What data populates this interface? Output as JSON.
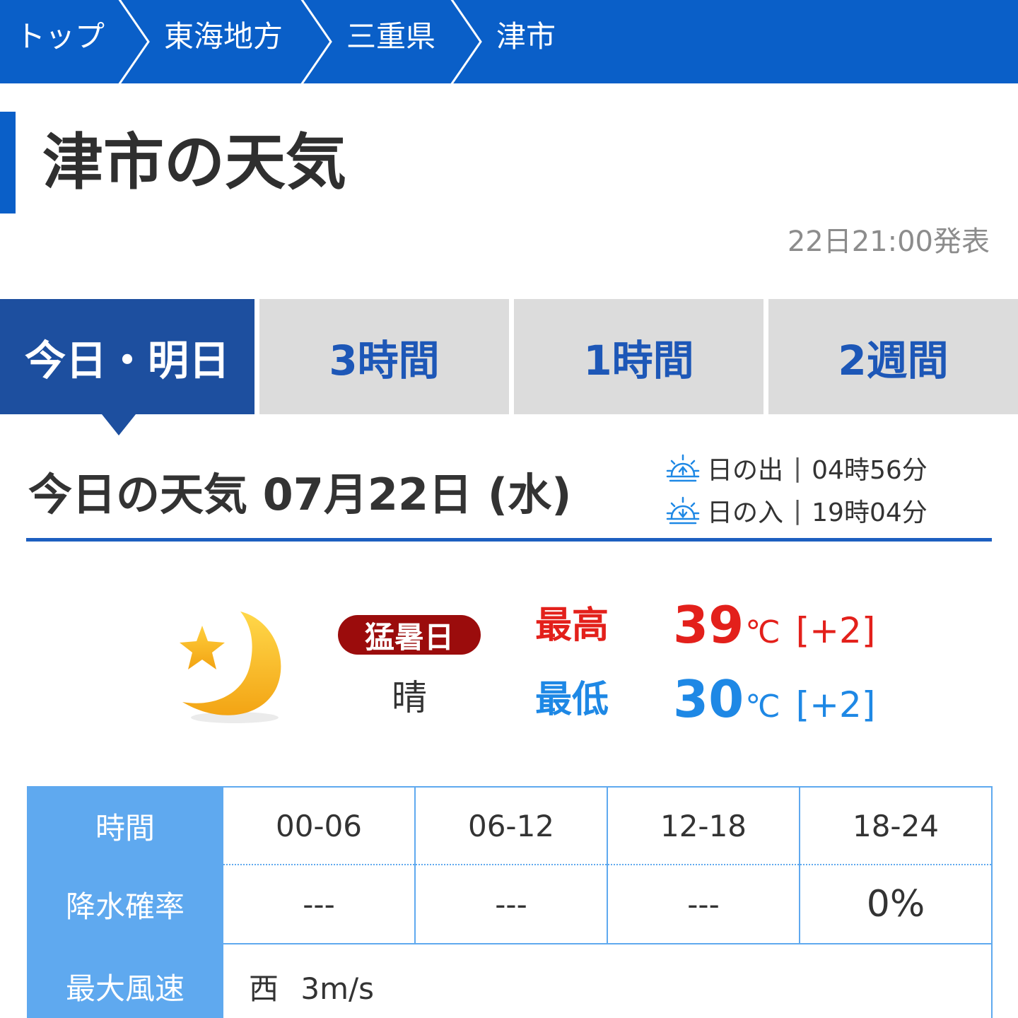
{
  "breadcrumb": {
    "items": [
      "トップ",
      "東海地方",
      "三重県",
      "津市"
    ]
  },
  "page": {
    "title": "津市の天気",
    "published": "22日21:00発表"
  },
  "tabs": [
    {
      "label": "今日・明日",
      "active": true
    },
    {
      "label": "3時間",
      "active": false
    },
    {
      "label": "1時間",
      "active": false
    },
    {
      "label": "2週間",
      "active": false
    }
  ],
  "today": {
    "heading": "今日の天気 07月22日 (水)",
    "sunrise": {
      "label": "日の出",
      "time": "04時56分",
      "icon": "sunrise-icon"
    },
    "sunset": {
      "label": "日の入",
      "time": "19時04分",
      "icon": "sunset-icon"
    },
    "weather_icon": "crescent-moon-with-star-icon",
    "badge": "猛暑日",
    "condition": "晴",
    "high": {
      "label": "最高",
      "value": "39",
      "unit": "℃",
      "diff": "[+2]"
    },
    "low": {
      "label": "最低",
      "value": "30",
      "unit": "℃",
      "diff": "[+2]"
    }
  },
  "table": {
    "time_header": "時間",
    "times": [
      "00-06",
      "06-12",
      "12-18",
      "18-24"
    ],
    "pop_header": "降水確率",
    "pop": [
      "---",
      "---",
      "---",
      "0%"
    ],
    "wind_header": "最大風速",
    "wind_direction": "西",
    "wind_speed": "3m/s"
  },
  "colors": {
    "brand_blue": "#0a5fc8",
    "active_tab": "#1d4f9f",
    "high_temp": "#e3201b",
    "low_temp": "#1e88e5",
    "badge": "#9b0c0c",
    "table_header": "#5fa9ef"
  }
}
